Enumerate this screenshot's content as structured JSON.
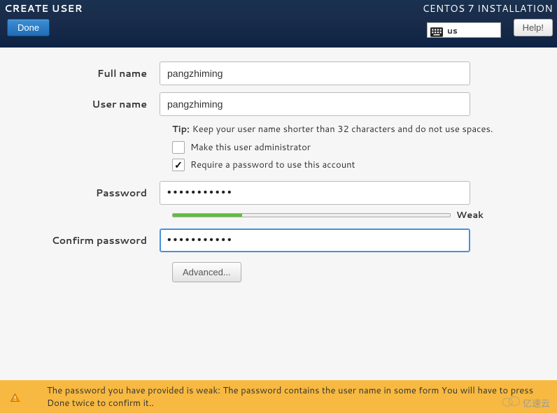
{
  "header": {
    "title_left": "CREATE USER",
    "title_right": "CENTOS 7 INSTALLATION",
    "done_label": "Done",
    "help_label": "Help!",
    "keyboard_layout": "us"
  },
  "form": {
    "full_name": {
      "label": "Full name",
      "value": "pangzhiming"
    },
    "user_name": {
      "label": "User name",
      "value": "pangzhiming"
    },
    "tip": {
      "label": "Tip:",
      "text": "Keep your user name shorter than 32 characters and do not use spaces."
    },
    "admin_checkbox": {
      "label": "Make this user administrator",
      "checked": false
    },
    "require_pw_checkbox": {
      "label": "Require a password to use this account",
      "checked": true
    },
    "password": {
      "label": "Password",
      "value": "•••••••••••"
    },
    "strength": {
      "label": "Weak",
      "fill_percent": 25
    },
    "confirm_password": {
      "label": "Confirm password",
      "value": "•••••••••••"
    },
    "advanced_label": "Advanced..."
  },
  "warning": {
    "text": "The password you have provided is weak: The password contains the user name in some form You will have to press Done twice to confirm it.."
  },
  "watermark": {
    "text": "亿速云"
  }
}
